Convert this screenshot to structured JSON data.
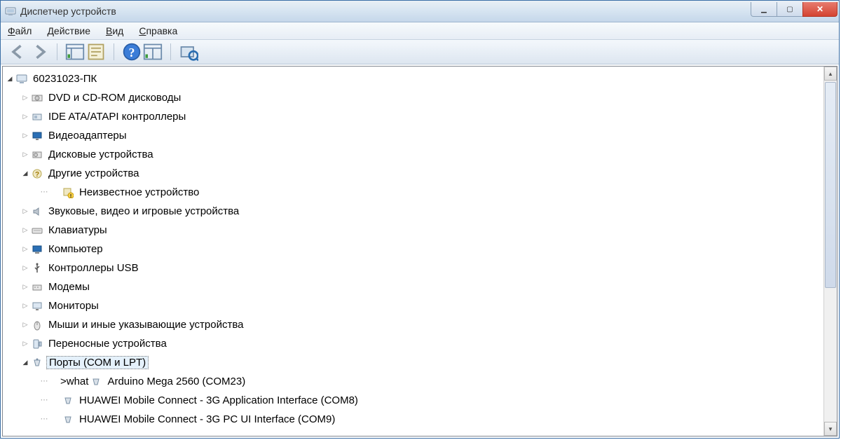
{
  "window": {
    "title": "Диспетчер устройств"
  },
  "menu": {
    "file": "Файл",
    "action": "Действие",
    "view": "Вид",
    "help": "Справка"
  },
  "toolbar": {
    "back": "Назад",
    "forward": "Вперёд",
    "show_hidden": "Показать скрытые устройства",
    "properties": "Свойства",
    "help": "Справка",
    "scan": "Обновить конфигурацию оборудования",
    "scan2": "Обновить"
  },
  "tree": {
    "root": "60231023-ПК",
    "dvd": "DVD и CD-ROM дисководы",
    "ide": "IDE ATA/ATAPI контроллеры",
    "video": "Видеоадаптеры",
    "disk": "Дисковые устройства",
    "other": "Другие устройства",
    "unknown": "Неизвестное устройство",
    "sound": "Звуковые, видео и игровые устройства",
    "keyboard": "Клавиатуры",
    "computer": "Компьютер",
    "usb": "Контроллеры USB",
    "modem": "Модемы",
    "monitor": "Мониторы",
    "mouse": "Мыши и иные указывающие устройства",
    "portable": "Переносные устройства",
    "ports": "Порты (COM и LPT)",
    "port_arduino": "Arduino Mega 2560 (COM23)",
    "port_huawei_app": "HUAWEI Mobile Connect - 3G Application Interface (COM8)",
    "port_huawei_pc": "HUAWEI Mobile Connect - 3G PC UI Interface (COM9)"
  }
}
